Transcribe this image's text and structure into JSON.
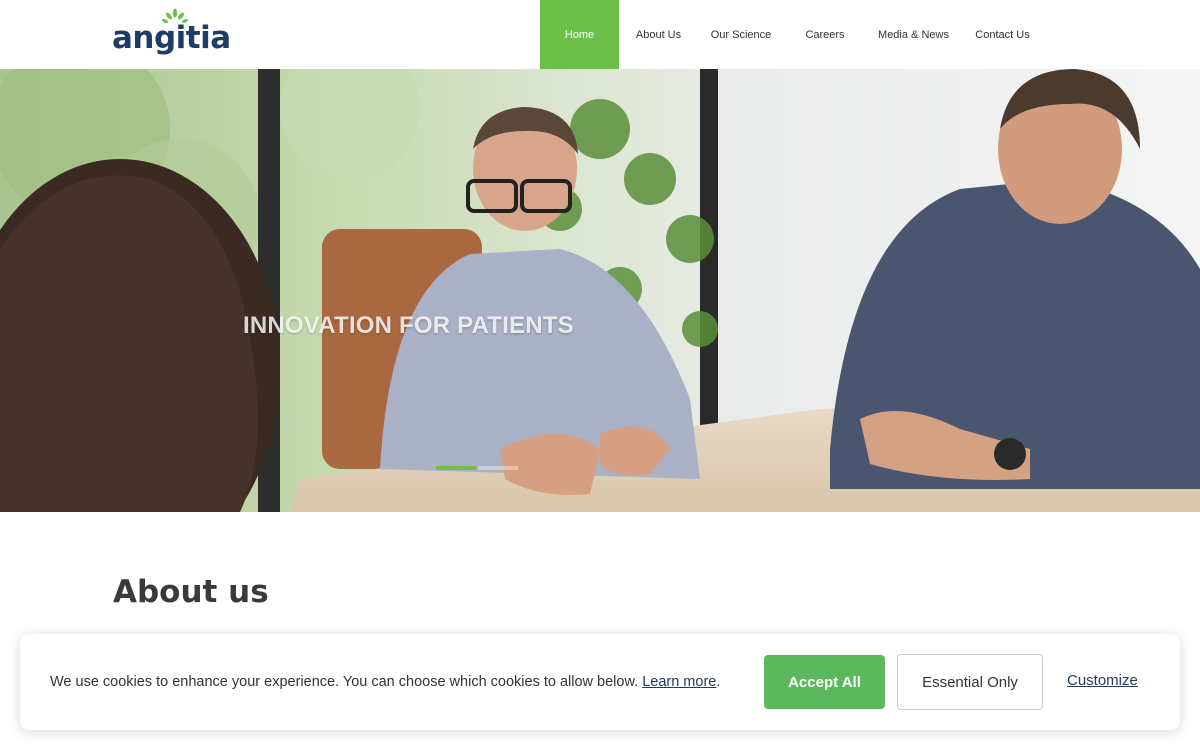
{
  "brand": {
    "name": "angitia",
    "logo_color": "#1f3b66",
    "leaf_color": "#6cc04a"
  },
  "nav": {
    "items": [
      {
        "label": "Home",
        "active": true
      },
      {
        "label": "About Us"
      },
      {
        "label": "Our Science"
      },
      {
        "label": "Careers"
      },
      {
        "label": "Media & News"
      },
      {
        "label": "Contact Us"
      }
    ]
  },
  "hero": {
    "title": "INNOVATION FOR PATIENTS",
    "active_slide": 1,
    "slide_count": 2
  },
  "about": {
    "title": "About us"
  },
  "cookie": {
    "message": "We use cookies to enhance your experience. You can choose which cookies to allow below.",
    "learn_more": "Learn more",
    "period": ".",
    "accept_label": "Accept All",
    "essential_label": "Essential Only",
    "customize_label": "Customize"
  },
  "colors": {
    "accent": "#6cc04a",
    "accept_button": "#5cb85c"
  }
}
